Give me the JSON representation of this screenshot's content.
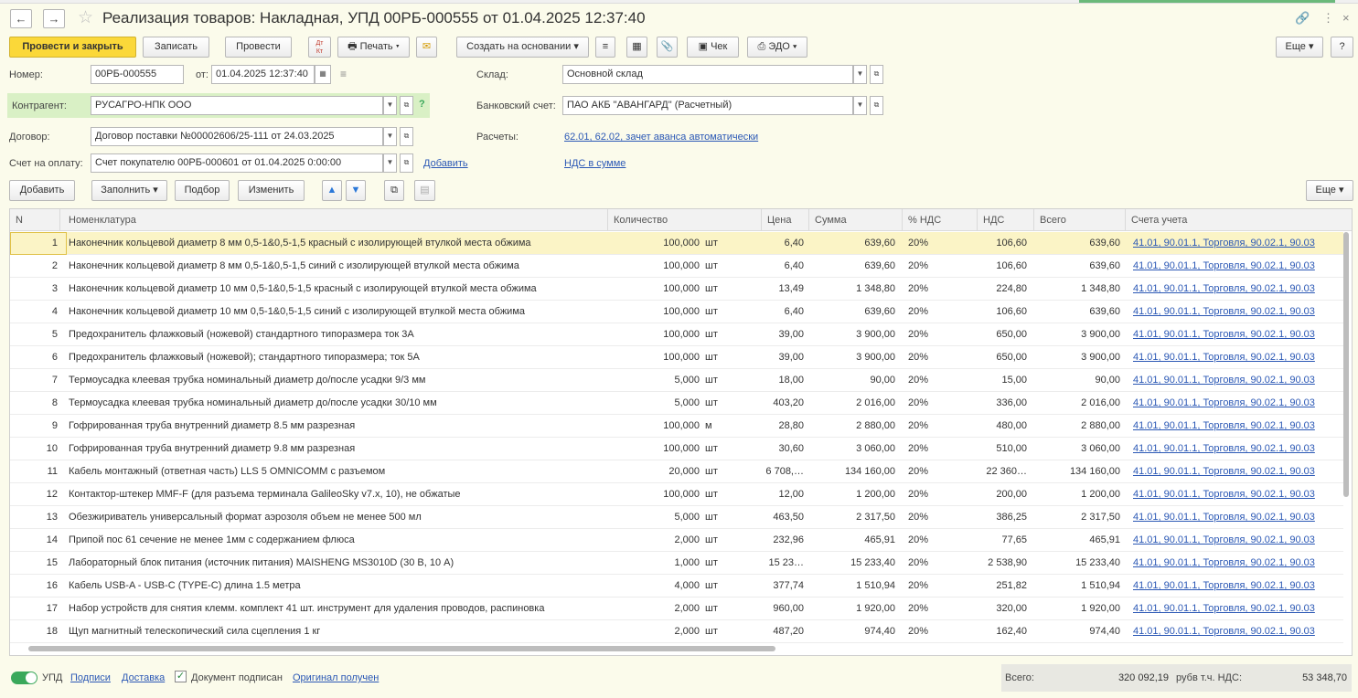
{
  "window": {
    "title": "Реализация товаров: Накладная, УПД 00РБ-000555 от 01.04.2025 12:37:40",
    "back_icon": "arrow-left-icon",
    "forward_icon": "arrow-right-icon"
  },
  "toolbar": {
    "post_close": "Провести и закрыть",
    "save": "Записать",
    "post": "Провести",
    "dtkt": "Дт\nКт",
    "print": "Печать",
    "create_basis": "Создать на основании",
    "check": "Чек",
    "edo": "ЭДО",
    "more": "Еще",
    "help": "?"
  },
  "form": {
    "number_label": "Номер:",
    "number_value": "00РБ-000555",
    "date_label": "от:",
    "date_value": "01.04.2025 12:37:40",
    "warehouse_label": "Склад:",
    "warehouse_value": "Основной склад",
    "counterparty_label": "Контрагент:",
    "counterparty_value": "РУСАГРО-НПК ООО",
    "bank_label": "Банковский счет:",
    "bank_value": "ПАО АКБ \"АВАНГАРД\" (Расчетный)",
    "contract_label": "Договор:",
    "contract_value": "Договор поставки №00002606/25-111 от 24.03.2025",
    "settlements_label": "Расчеты:",
    "settlements_link": "62.01, 62.02, зачет аванса автоматически",
    "invoice_label": "Счет на оплату:",
    "invoice_value": "Счет покупателю 00РБ-000601 от 01.04.2025 0:00:00",
    "add_link": "Добавить",
    "vat_link": "НДС в сумме"
  },
  "table_toolbar": {
    "add": "Добавить",
    "fill": "Заполнить",
    "select": "Подбор",
    "change": "Изменить",
    "more": "Еще"
  },
  "table": {
    "columns": [
      "N",
      "Номенклатура",
      "Количество",
      "Цена",
      "Сумма",
      "% НДС",
      "НДС",
      "Всего",
      "Счета учета"
    ],
    "rows": [
      {
        "n": "1",
        "name": "Наконечник кольцевой диаметр 8 мм 0,5-1&0,5-1,5 красный с изолирующей втулкой места обжима",
        "qty": "100,000",
        "unit": "шт",
        "price": "6,40",
        "sum": "639,60",
        "vatp": "20%",
        "vat": "106,60",
        "total": "639,60",
        "acc": "41.01, 90.01.1, Торговля, 90.02.1, 90.03"
      },
      {
        "n": "2",
        "name": "Наконечник кольцевой диаметр 8 мм 0,5-1&0,5-1,5 синий с изолирующей втулкой места обжима",
        "qty": "100,000",
        "unit": "шт",
        "price": "6,40",
        "sum": "639,60",
        "vatp": "20%",
        "vat": "106,60",
        "total": "639,60",
        "acc": "41.01, 90.01.1, Торговля, 90.02.1, 90.03"
      },
      {
        "n": "3",
        "name": "Наконечник кольцевой диаметр 10 мм 0,5-1&0,5-1,5 красный с изолирующей втулкой места обжима",
        "qty": "100,000",
        "unit": "шт",
        "price": "13,49",
        "sum": "1 348,80",
        "vatp": "20%",
        "vat": "224,80",
        "total": "1 348,80",
        "acc": "41.01, 90.01.1, Торговля, 90.02.1, 90.03"
      },
      {
        "n": "4",
        "name": "Наконечник кольцевой диаметр 10 мм 0,5-1&0,5-1,5 синий с изолирующей втулкой места обжима",
        "qty": "100,000",
        "unit": "шт",
        "price": "6,40",
        "sum": "639,60",
        "vatp": "20%",
        "vat": "106,60",
        "total": "639,60",
        "acc": "41.01, 90.01.1, Торговля, 90.02.1, 90.03"
      },
      {
        "n": "5",
        "name": "Предохранитель флажковый (ножевой) стандартного типоразмера ток 3А",
        "qty": "100,000",
        "unit": "шт",
        "price": "39,00",
        "sum": "3 900,00",
        "vatp": "20%",
        "vat": "650,00",
        "total": "3 900,00",
        "acc": "41.01, 90.01.1, Торговля, 90.02.1, 90.03"
      },
      {
        "n": "6",
        "name": "Предохранитель флажковый (ножевой); стандартного типоразмера; ток 5А",
        "qty": "100,000",
        "unit": "шт",
        "price": "39,00",
        "sum": "3 900,00",
        "vatp": "20%",
        "vat": "650,00",
        "total": "3 900,00",
        "acc": "41.01, 90.01.1, Торговля, 90.02.1, 90.03"
      },
      {
        "n": "7",
        "name": "Термоусадка клеевая трубка номинальный диаметр до/после усадки 9/3 мм",
        "qty": "5,000",
        "unit": "шт",
        "price": "18,00",
        "sum": "90,00",
        "vatp": "20%",
        "vat": "15,00",
        "total": "90,00",
        "acc": "41.01, 90.01.1, Торговля, 90.02.1, 90.03"
      },
      {
        "n": "8",
        "name": "Термоусадка клеевая трубка номинальный диаметр до/после усадки 30/10 мм",
        "qty": "5,000",
        "unit": "шт",
        "price": "403,20",
        "sum": "2 016,00",
        "vatp": "20%",
        "vat": "336,00",
        "total": "2 016,00",
        "acc": "41.01, 90.01.1, Торговля, 90.02.1, 90.03"
      },
      {
        "n": "9",
        "name": "Гофрированная труба внутренний диаметр 8.5 мм разрезная",
        "qty": "100,000",
        "unit": "м",
        "price": "28,80",
        "sum": "2 880,00",
        "vatp": "20%",
        "vat": "480,00",
        "total": "2 880,00",
        "acc": "41.01, 90.01.1, Торговля, 90.02.1, 90.03"
      },
      {
        "n": "10",
        "name": "Гофрированная труба внутренний диаметр 9.8 мм разрезная",
        "qty": "100,000",
        "unit": "шт",
        "price": "30,60",
        "sum": "3 060,00",
        "vatp": "20%",
        "vat": "510,00",
        "total": "3 060,00",
        "acc": "41.01, 90.01.1, Торговля, 90.02.1, 90.03"
      },
      {
        "n": "11",
        "name": "Кабель монтажный (ответная часть) LLS 5 OMNICOMM с разъемом",
        "qty": "20,000",
        "unit": "шт",
        "price": "6 708,…",
        "sum": "134 160,00",
        "vatp": "20%",
        "vat": "22 360…",
        "total": "134 160,00",
        "acc": "41.01, 90.01.1, Торговля, 90.02.1, 90.03"
      },
      {
        "n": "12",
        "name": "Контактор-штекер MMF-F (для разъема терминала GalileoSky v7.x, 10), не обжатые",
        "qty": "100,000",
        "unit": "шт",
        "price": "12,00",
        "sum": "1 200,00",
        "vatp": "20%",
        "vat": "200,00",
        "total": "1 200,00",
        "acc": "41.01, 90.01.1, Торговля, 90.02.1, 90.03"
      },
      {
        "n": "13",
        "name": "Обезжириватель универсальный формат аэрозоля объем не менее 500 мл",
        "qty": "5,000",
        "unit": "шт",
        "price": "463,50",
        "sum": "2 317,50",
        "vatp": "20%",
        "vat": "386,25",
        "total": "2 317,50",
        "acc": "41.01, 90.01.1, Торговля, 90.02.1, 90.03"
      },
      {
        "n": "14",
        "name": "Припой пос 61 сечение не менее 1мм с содержанием флюса",
        "qty": "2,000",
        "unit": "шт",
        "price": "232,96",
        "sum": "465,91",
        "vatp": "20%",
        "vat": "77,65",
        "total": "465,91",
        "acc": "41.01, 90.01.1, Торговля, 90.02.1, 90.03"
      },
      {
        "n": "15",
        "name": "Лабораторный блок питания (источник питания) MAISHENG MS3010D (30 В, 10 А)",
        "qty": "1,000",
        "unit": "шт",
        "price": "15 23…",
        "sum": "15 233,40",
        "vatp": "20%",
        "vat": "2 538,90",
        "total": "15 233,40",
        "acc": "41.01, 90.01.1, Торговля, 90.02.1, 90.03"
      },
      {
        "n": "16",
        "name": "Кабель USB-A - USB-C (TYPE-C) длина 1.5 метра",
        "qty": "4,000",
        "unit": "шт",
        "price": "377,74",
        "sum": "1 510,94",
        "vatp": "20%",
        "vat": "251,82",
        "total": "1 510,94",
        "acc": "41.01, 90.01.1, Торговля, 90.02.1, 90.03"
      },
      {
        "n": "17",
        "name": "Набор устройств для снятия клемм. комплект 41 шт. инструмент для удаления проводов, распиновка",
        "qty": "2,000",
        "unit": "шт",
        "price": "960,00",
        "sum": "1 920,00",
        "vatp": "20%",
        "vat": "320,00",
        "total": "1 920,00",
        "acc": "41.01, 90.01.1, Торговля, 90.02.1, 90.03"
      },
      {
        "n": "18",
        "name": "Щуп магнитный телескопический сила сцепления 1 кг",
        "qty": "2,000",
        "unit": "шт",
        "price": "487,20",
        "sum": "974,40",
        "vatp": "20%",
        "vat": "162,40",
        "total": "974,40",
        "acc": "41.01, 90.01.1, Торговля, 90.02.1, 90.03"
      }
    ]
  },
  "footer": {
    "upd_label": "УПД",
    "signatures_link": "Подписи",
    "delivery_link": "Доставка",
    "signed_label": "Документ подписан",
    "original_link": "Оригинал получен",
    "total_label": "Всего:",
    "total_value": "320 092,19",
    "currency": "руб.",
    "vat_label": "в т.ч. НДС:",
    "vat_value": "53 348,70"
  },
  "colors": {
    "primary_button": "#fbd839",
    "link": "#2b58b5",
    "selected_row": "#fbf4c6",
    "counterparty_highlight": "#d9f0c5",
    "toggle": "#3aa85b"
  }
}
